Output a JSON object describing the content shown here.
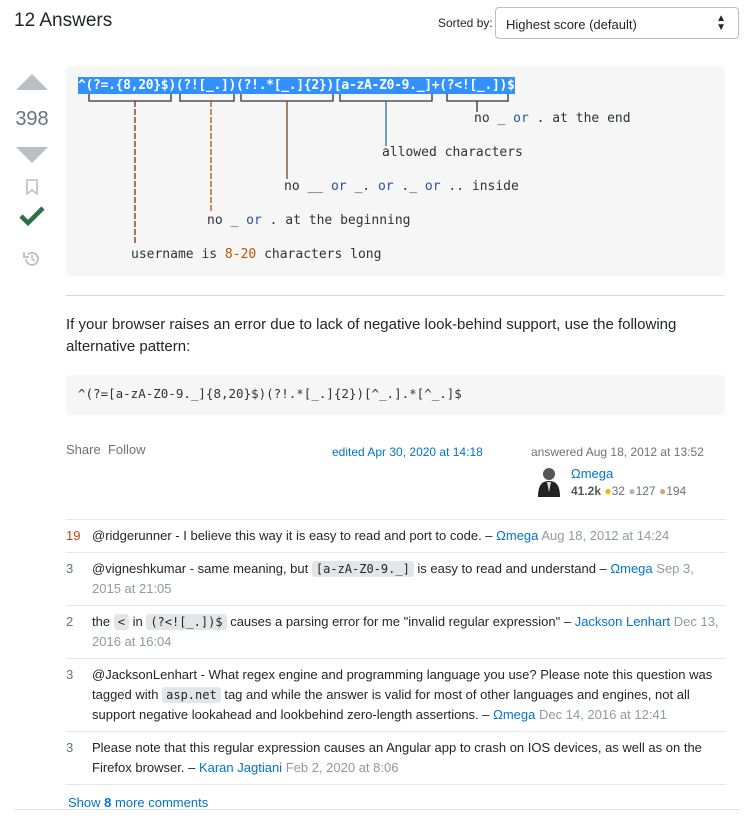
{
  "header": {
    "title": "12 Answers",
    "sort_label": "Sorted by:",
    "sort_value": "Highest score (default)"
  },
  "answer": {
    "score": "398",
    "diagram": {
      "regex": "^(?=.{8,20}$)(?![_.])(?!.*[_.]{2})[a-zA-Z0-9._]+(?<![_.])$",
      "annotations": [
        {
          "no": "no _",
          "or": "or",
          "rest": ". at the end"
        },
        {
          "text": "allowed characters"
        },
        {
          "a": "no __",
          "b": "or",
          "c": "_.",
          "d": "or",
          "e": "._",
          "f": "or",
          "g": ".. inside"
        },
        {
          "a": "no _",
          "b": "or",
          "c": ". at the beginning"
        },
        {
          "a": "username is",
          "b": "8-20",
          "c": "characters long"
        }
      ]
    },
    "paragraph": "If your browser raises an error due to lack of negative look-behind support, use the following alternative pattern:",
    "alt_pattern": "^(?=[a-zA-Z0-9._]{8,20}$)(?!.*[_.]{2})[^_.].*[^_.]$",
    "share": "Share",
    "follow": "Follow",
    "edited": "edited Apr 30, 2020 at 14:18",
    "answered": "answered Aug 18, 2012 at 13:52",
    "user": {
      "name": "Ωmega",
      "rep": "41.2k",
      "gold": "32",
      "silver": "127",
      "bronze": "194"
    }
  },
  "comments": [
    {
      "score": "19",
      "text": "@ridgerunner - I believe this way it is easy to read and port to code. –",
      "user": "Ωmega",
      "date": "Aug 18, 2012 at 14:24"
    },
    {
      "score": "3",
      "text": "@vigneshkumar - same meaning, but",
      "code": "[a-zA-Z0-9._]",
      "text2": "is easy to read and understand –",
      "user": "Ωmega",
      "date": "Sep 3, 2015 at 21:05"
    },
    {
      "score": "2",
      "text": "the",
      "code": "<",
      "text2": "in",
      "code2": "(?<![_.])$",
      "text3": "causes a parsing error for me \"invalid regular expression\" –",
      "user": "Jackson Lenhart",
      "date": "Dec 13, 2016 at 16:04"
    },
    {
      "score": "3",
      "text": "@JacksonLenhart - What regex engine and programming language you use? Please note this question was tagged with",
      "code": "asp.net",
      "text2": "tag and while the answer is valid for most of other languages and engines, not all support negative lookahead and lookbehind zero-length assertions. –",
      "user": "Ωmega",
      "date": "Dec 14, 2016 at 12:41"
    },
    {
      "score": "3",
      "text": "Please note that this regular expression causes an Angular app to crash on IOS devices, as well as on the Firefox browser. –",
      "user": "Karan Jagtiani",
      "date": "Feb 2, 2020 at 8:06"
    }
  ],
  "show_more": {
    "pre": "Show",
    "count": "8",
    "post": "more comments"
  }
}
